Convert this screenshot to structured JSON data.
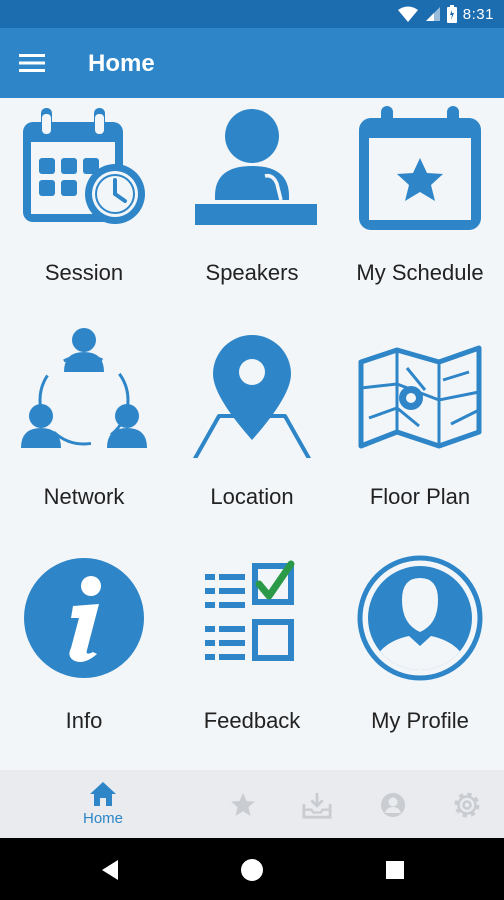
{
  "status_bar": {
    "time": "8:31"
  },
  "app_bar": {
    "title": "Home"
  },
  "tiles": [
    {
      "label": "Session",
      "icon": "calendar-clock-icon"
    },
    {
      "label": "Speakers",
      "icon": "speaker-podium-icon"
    },
    {
      "label": "My Schedule",
      "icon": "calendar-star-icon"
    },
    {
      "label": "Network",
      "icon": "network-people-icon"
    },
    {
      "label": "Location",
      "icon": "map-pin-icon"
    },
    {
      "label": "Floor Plan",
      "icon": "floor-map-icon"
    },
    {
      "label": "Info",
      "icon": "info-icon"
    },
    {
      "label": "Feedback",
      "icon": "checklist-icon"
    },
    {
      "label": "My Profile",
      "icon": "profile-icon"
    }
  ],
  "bottom_nav": {
    "home_label": "Home",
    "items": [
      "home-icon",
      "star-icon",
      "inbox-download-icon",
      "account-icon",
      "settings-icon"
    ]
  },
  "colors": {
    "primary": "#2e86c8",
    "status_bar": "#1c6cb0",
    "background": "#f3f6f9",
    "inactive_nav_icon": "#c9ccd1"
  }
}
